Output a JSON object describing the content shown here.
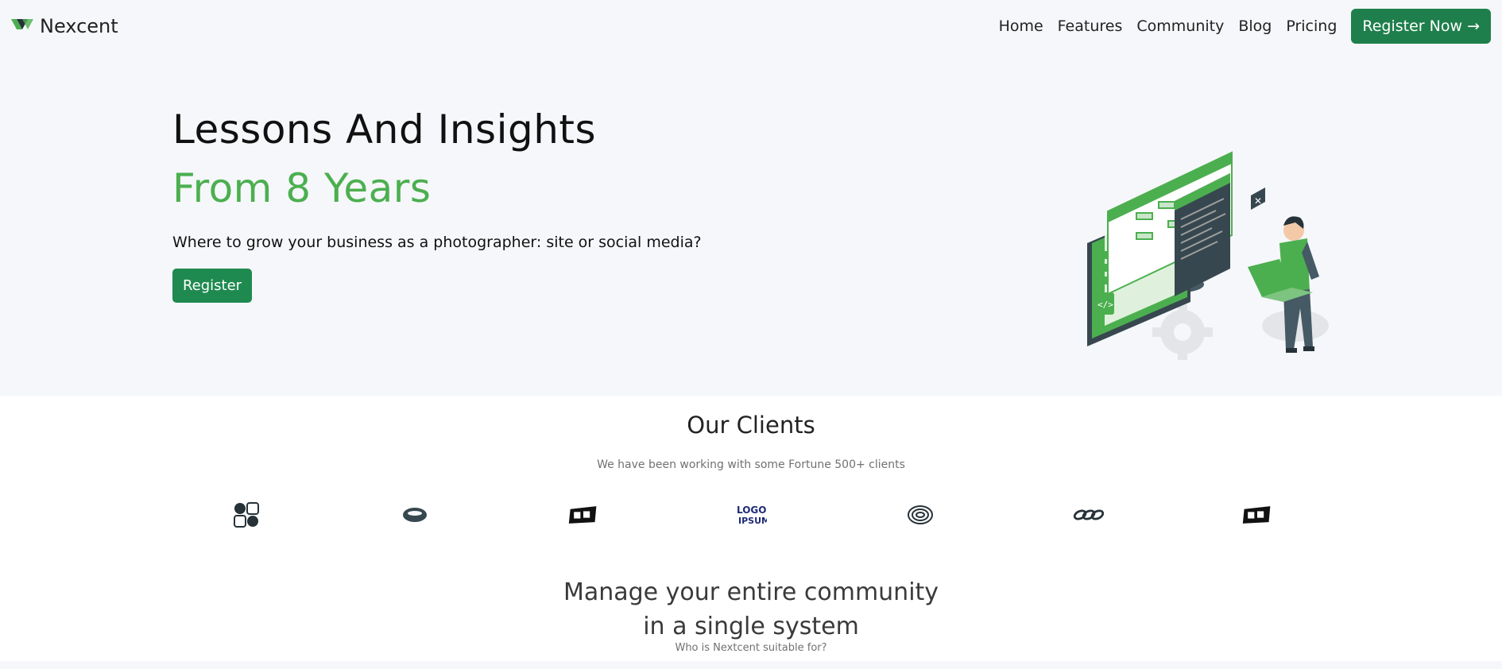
{
  "navbar": {
    "brand": "Nexcent",
    "links": [
      "Home",
      "Features",
      "Community",
      "Blog",
      "Pricing"
    ],
    "cta": "Register Now →"
  },
  "hero": {
    "title": "Lessons And Insights",
    "title_accent": "From 8 Years",
    "subtitle": "Where to grow your business as a photographer: site or social media?",
    "button": "Register"
  },
  "clients": {
    "title": "Our Clients",
    "subtitle": "We have been working with some Fortune 500+ clients",
    "logo_text": "LOGO IPSUM"
  },
  "community": {
    "title_line1": "Manage your entire community",
    "title_line2": "in a single system",
    "subtitle": "Who is Nextcent suitable for?"
  },
  "colors": {
    "brand_green": "#4caf4f",
    "button_green": "#1f8a50",
    "background": "#f5f7fa"
  }
}
